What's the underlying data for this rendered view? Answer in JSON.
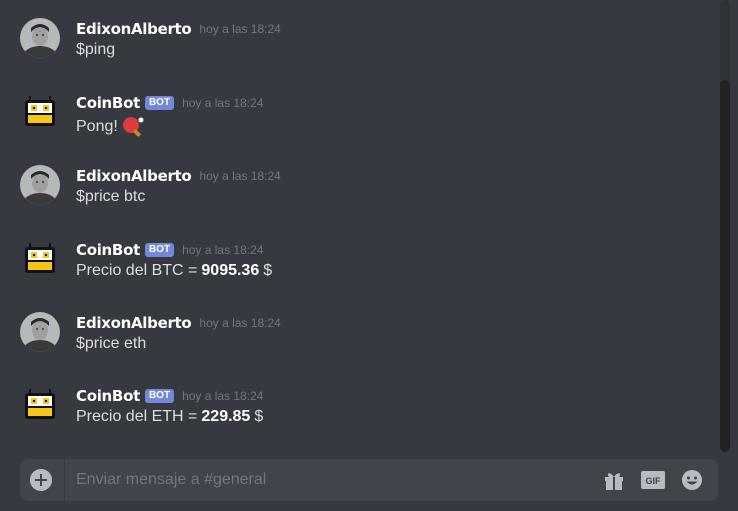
{
  "colors": {
    "background": "#36393f",
    "username": "#ffffff",
    "message_text": "#dcddde",
    "timestamp": "#72767d",
    "bot_tag": "#7289da",
    "composer_bg": "#40444b"
  },
  "messages": [
    {
      "author": "EdixonAlberto",
      "avatar_icon": "user-photo-avatar",
      "is_bot": false,
      "timestamp": "hoy a las 18:24",
      "text": "$ping"
    },
    {
      "author": "CoinBot",
      "avatar_icon": "robot-avatar",
      "is_bot": true,
      "bot_tag": "BOT",
      "timestamp": "hoy a las 18:24",
      "text": "Pong!",
      "emoji_icon": "ping-pong-icon"
    },
    {
      "author": "EdixonAlberto",
      "avatar_icon": "user-photo-avatar",
      "is_bot": false,
      "timestamp": "hoy a las 18:24",
      "text": "$price btc"
    },
    {
      "author": "CoinBot",
      "avatar_icon": "robot-avatar",
      "is_bot": true,
      "bot_tag": "BOT",
      "timestamp": "hoy a las 18:24",
      "text_prefix": "Precio del BTC =",
      "value": "9095.36",
      "text_suffix": "$"
    },
    {
      "author": "EdixonAlberto",
      "avatar_icon": "user-photo-avatar",
      "is_bot": false,
      "timestamp": "hoy a las 18:24",
      "text": "$price eth"
    },
    {
      "author": "CoinBot",
      "avatar_icon": "robot-avatar",
      "is_bot": true,
      "bot_tag": "BOT",
      "timestamp": "hoy a las 18:24",
      "text_prefix": "Precio del ETH =",
      "value": "229.85",
      "text_suffix": "$"
    }
  ],
  "composer": {
    "placeholder": "Enviar mensaje a #general",
    "add_icon": "plus-circle-icon",
    "gift_icon": "gift-icon",
    "gif_label": "GIF",
    "emoji_icon": "smiley-icon"
  }
}
